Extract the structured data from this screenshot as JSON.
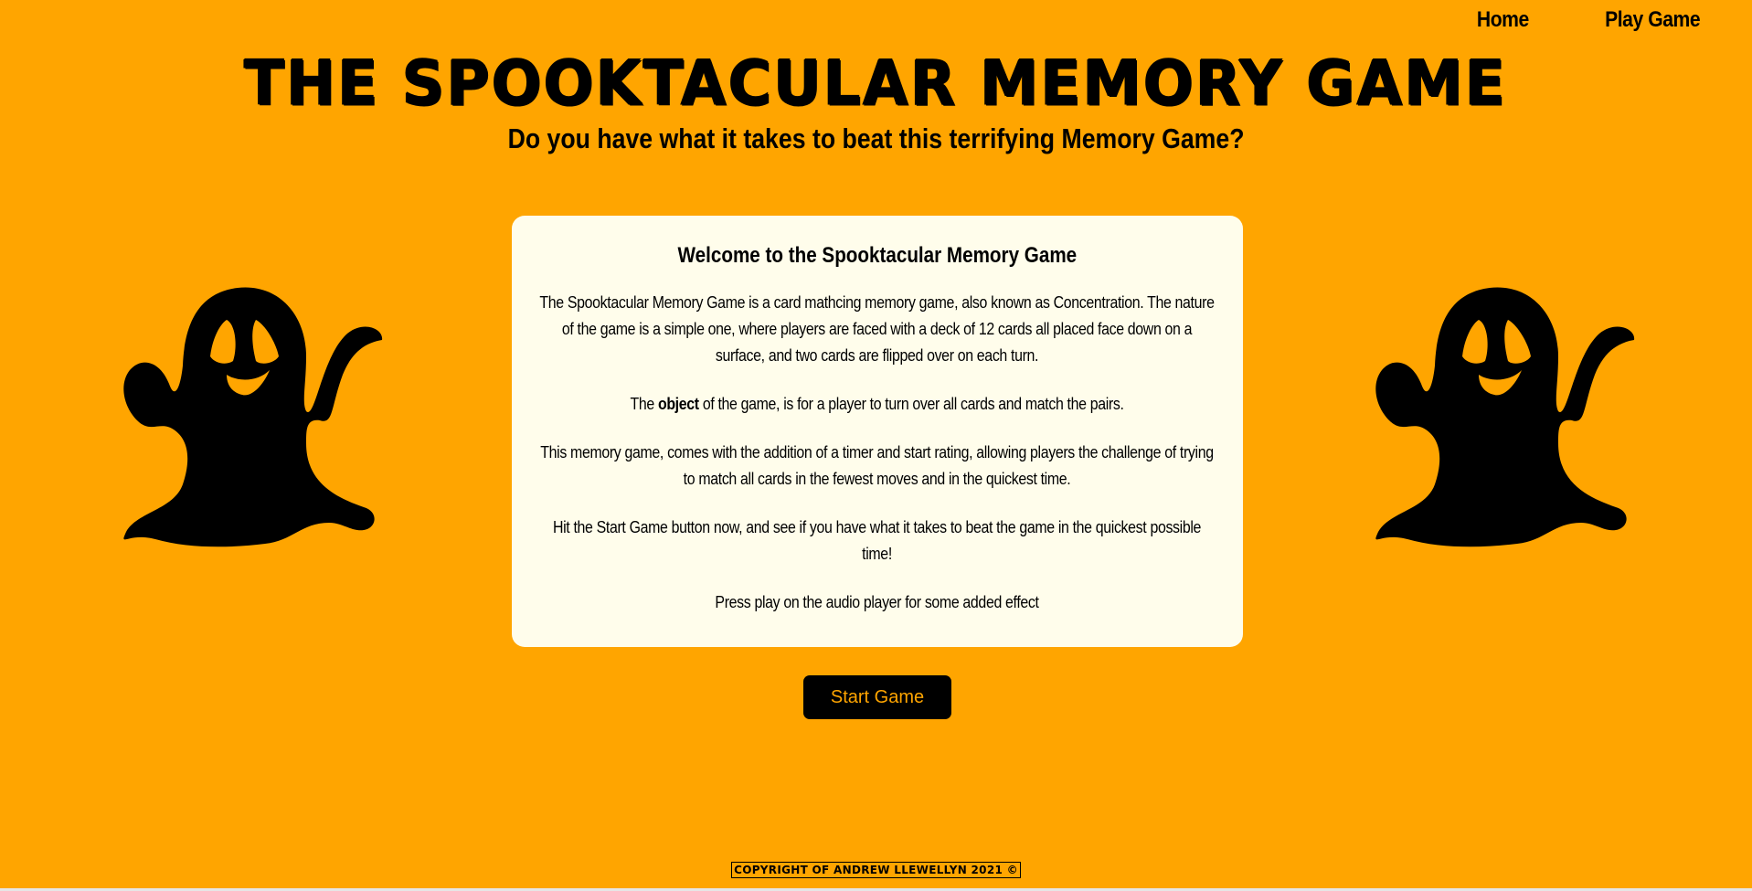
{
  "nav": {
    "home": "Home",
    "play": "Play Game"
  },
  "header": {
    "title": "THE SPOOKTACULAR MEMORY GAME",
    "subtitle": "Do you have what it takes to beat this terrifying Memory Game?"
  },
  "card": {
    "heading": "Welcome to the Spooktacular Memory Game",
    "p1": "The Spooktacular Memory Game is a card mathcing memory game, also known as Concentration. The nature of the game is a simple one, where players are faced with a deck of 12 cards all placed face down on a surface, and two cards are flipped over on each turn.",
    "p2_pre": "The ",
    "p2_bold": "object",
    "p2_post": " of the game, is for a player to turn over all cards and match the pairs.",
    "p3": "This memory game, comes with the addition of a timer and start rating, allowing players the challenge of trying to match all cards in the fewest moves and in the quickest time.",
    "p4": "Hit the Start Game button now, and see if you have what it takes to beat the game in the quickest possible time!",
    "p5": "Press play on the audio player for some added effect"
  },
  "actions": {
    "start_label": "Start Game"
  },
  "footer": {
    "copyright": "Copyright of Andrew Llewellyn 2021 ©"
  },
  "colors": {
    "background": "#FFA500",
    "card": "#FFFDEB",
    "ghost": "#000000",
    "ghost_features": "#FFA500"
  },
  "icons": {
    "ghost_left": "ghost-icon",
    "ghost_right": "ghost-icon"
  }
}
